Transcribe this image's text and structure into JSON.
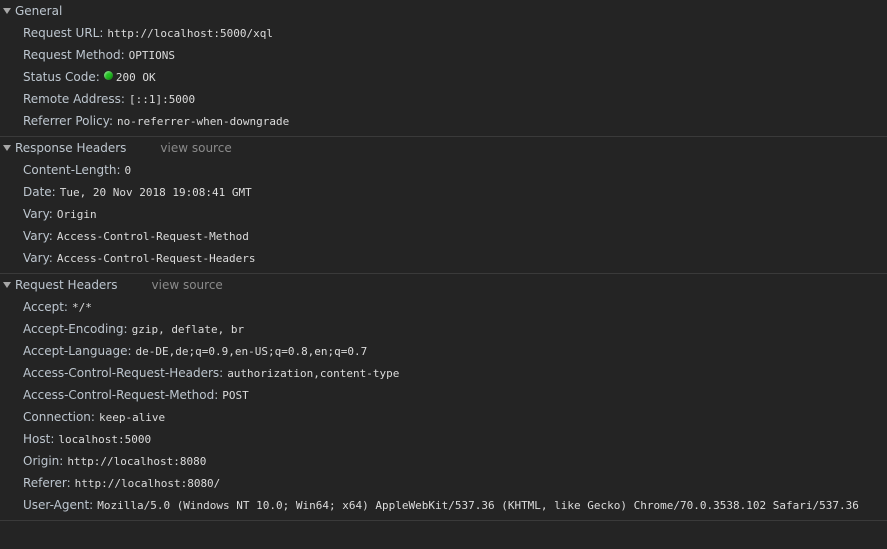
{
  "general": {
    "title": "General",
    "rows": [
      {
        "name": "Request URL:",
        "value": "http://localhost:5000/xql"
      },
      {
        "name": "Request Method:",
        "value": "OPTIONS"
      },
      {
        "name": "Status Code:",
        "value": "200 OK"
      },
      {
        "name": "Remote Address:",
        "value": "[::1]:5000"
      },
      {
        "name": "Referrer Policy:",
        "value": "no-referrer-when-downgrade"
      }
    ]
  },
  "response_headers": {
    "title": "Response Headers",
    "view_source": "view source",
    "rows": [
      {
        "name": "Content-Length:",
        "value": "0"
      },
      {
        "name": "Date:",
        "value": "Tue, 20 Nov 2018 19:08:41 GMT"
      },
      {
        "name": "Vary:",
        "value": "Origin"
      },
      {
        "name": "Vary:",
        "value": "Access-Control-Request-Method"
      },
      {
        "name": "Vary:",
        "value": "Access-Control-Request-Headers"
      }
    ]
  },
  "request_headers": {
    "title": "Request Headers",
    "view_source": "view source",
    "rows": [
      {
        "name": "Accept:",
        "value": "*/*"
      },
      {
        "name": "Accept-Encoding:",
        "value": "gzip, deflate, br"
      },
      {
        "name": "Accept-Language:",
        "value": "de-DE,de;q=0.9,en-US;q=0.8,en;q=0.7"
      },
      {
        "name": "Access-Control-Request-Headers:",
        "value": "authorization,content-type"
      },
      {
        "name": "Access-Control-Request-Method:",
        "value": "POST"
      },
      {
        "name": "Connection:",
        "value": "keep-alive"
      },
      {
        "name": "Host:",
        "value": "localhost:5000"
      },
      {
        "name": "Origin:",
        "value": "http://localhost:8080"
      },
      {
        "name": "Referer:",
        "value": "http://localhost:8080/"
      },
      {
        "name": "User-Agent:",
        "value": "Mozilla/5.0 (Windows NT 10.0; Win64; x64) AppleWebKit/537.36 (KHTML, like Gecko) Chrome/70.0.3538.102 Safari/537.36"
      }
    ]
  },
  "colors": {
    "background": "#242424",
    "status_ok": "#1fc21f"
  }
}
